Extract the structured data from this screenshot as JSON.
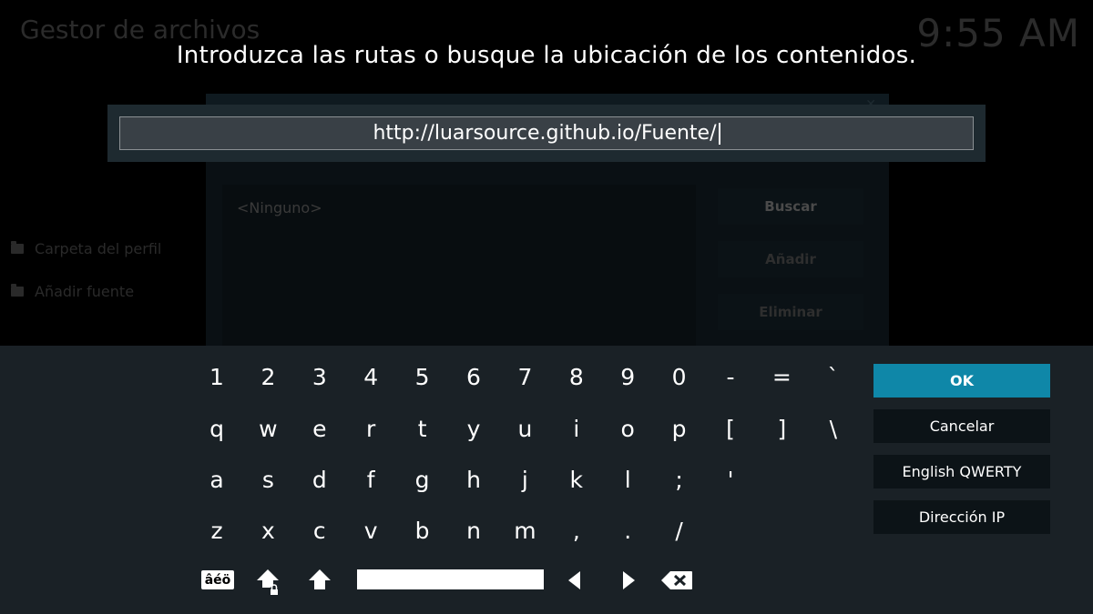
{
  "background": {
    "window_title": "Gestor de archivos",
    "clock": "9:55 AM",
    "sidebar": [
      {
        "label": "Carpeta del perfil",
        "icon": "folder-icon"
      },
      {
        "label": "Añadir fuente",
        "icon": "folder-icon"
      }
    ],
    "source_list_item": "<Ninguno>",
    "dialog_buttons": [
      "Buscar",
      "Añadir",
      "Eliminar"
    ]
  },
  "prompt": "Introduzca las rutas o busque la ubicación de los contenidos.",
  "input": {
    "value": "http://luarsource.github.io/Fuente/"
  },
  "keyboard": {
    "rows": [
      [
        "1",
        "2",
        "3",
        "4",
        "5",
        "6",
        "7",
        "8",
        "9",
        "0",
        "-",
        "=",
        "`"
      ],
      [
        "q",
        "w",
        "e",
        "r",
        "t",
        "y",
        "u",
        "i",
        "o",
        "p",
        "[",
        "]",
        "\\"
      ],
      [
        "a",
        "s",
        "d",
        "f",
        "g",
        "h",
        "j",
        "k",
        "l",
        ";",
        "'"
      ],
      [
        "z",
        "x",
        "c",
        "v",
        "b",
        "n",
        "m",
        ",",
        ".",
        "/"
      ]
    ],
    "accent_key_label": "âéö",
    "special_keys": [
      "caps-lock-icon",
      "shift-icon",
      "space-bar",
      "arrow-left-icon",
      "arrow-right-icon",
      "backspace-icon"
    ]
  },
  "buttons": {
    "ok": "OK",
    "cancel": "Cancelar",
    "layout": "English QWERTY",
    "ip": "Dirección IP"
  },
  "colors": {
    "accent": "#0f87a8",
    "keyboard_bg": "#1a2126",
    "input_panel_bg": "#1e2a30"
  }
}
